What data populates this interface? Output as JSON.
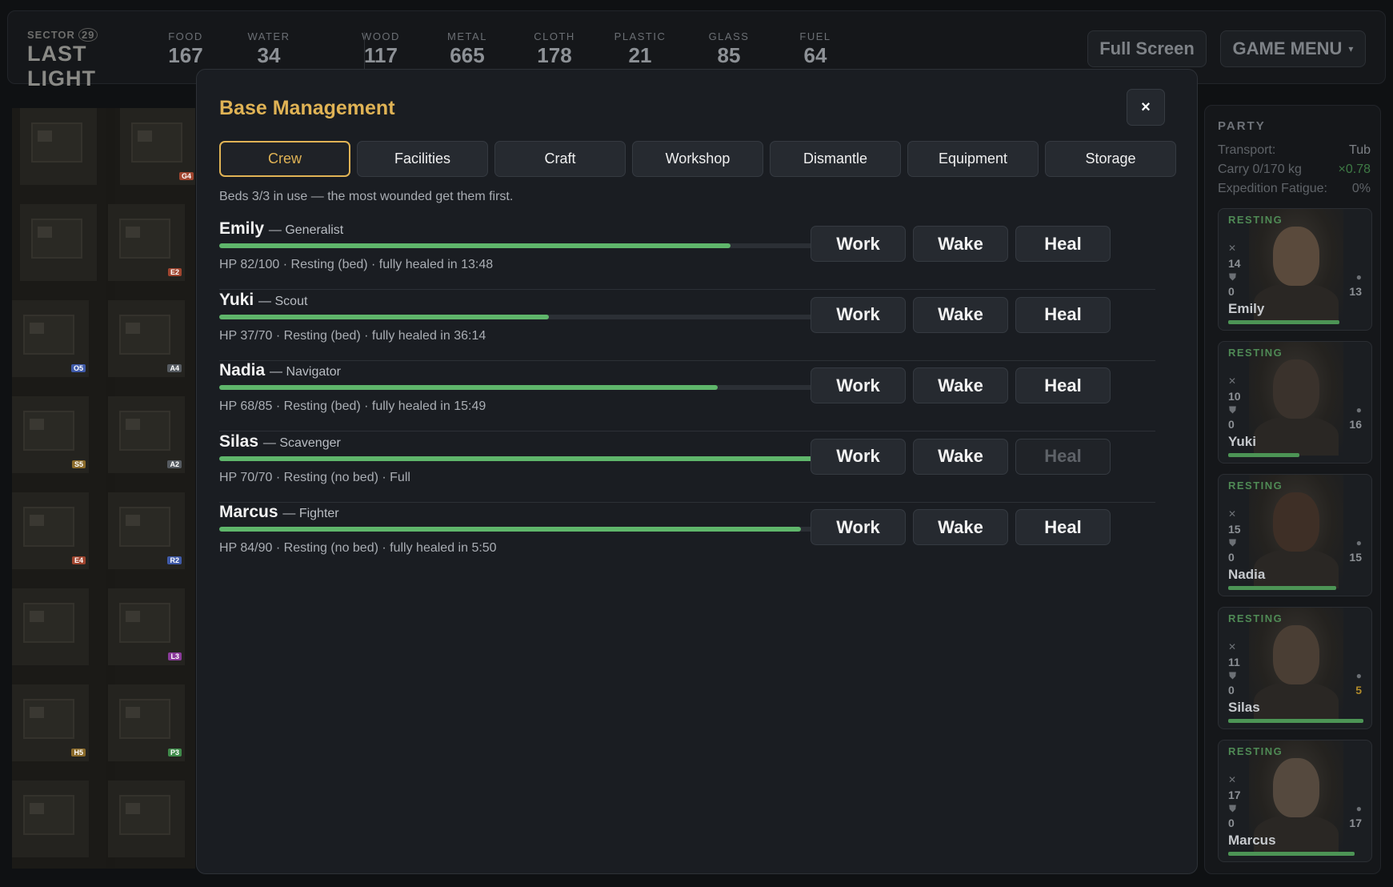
{
  "logo": {
    "line1": "SECTOR",
    "line1_num": "29",
    "line2": "LAST LIGHT"
  },
  "resources": [
    {
      "label": "FOOD",
      "value": "167"
    },
    {
      "label": "WATER",
      "value": "34"
    },
    {
      "label": "WOOD",
      "value": "117"
    },
    {
      "label": "METAL",
      "value": "665"
    },
    {
      "label": "CLOTH",
      "value": "178"
    },
    {
      "label": "PLASTIC",
      "value": "21"
    },
    {
      "label": "GLASS",
      "value": "85"
    },
    {
      "label": "FUEL",
      "value": "64"
    }
  ],
  "header": {
    "fullscreen_label": "Full Screen",
    "menu_label": "GAME MENU",
    "menu_caret": "▾"
  },
  "map": {
    "tiles": [
      {
        "tag": "G4",
        "tag_color": "#a0452f"
      },
      {
        "tag": "E2",
        "tag_color": "#a0452f"
      },
      {
        "tag": "O5",
        "tag_color": "#3f5aa8"
      },
      {
        "tag": "A4",
        "tag_color": "#555a60"
      },
      {
        "tag": "S5",
        "tag_color": "#8a6a2a"
      },
      {
        "tag": "A2",
        "tag_color": "#555a60"
      },
      {
        "tag": "E4",
        "tag_color": "#a0452f"
      },
      {
        "tag": "R2",
        "tag_color": "#3f5aa8"
      },
      {
        "tag": "L3",
        "tag_color": "#8a3a9a"
      },
      {
        "tag": "H5",
        "tag_color": "#8a6a2a"
      },
      {
        "tag": "P3",
        "tag_color": "#3f8a4a"
      }
    ]
  },
  "modal": {
    "title": "Base Management",
    "close_label": "×",
    "tabs": [
      "Crew",
      "Facilities",
      "Craft",
      "Workshop",
      "Dismantle",
      "Equipment",
      "Storage"
    ],
    "active_tab": "Crew",
    "beds_note": "Beds 3/3 in use — the most wounded get them first.",
    "crew": [
      {
        "name": "Emily",
        "role": "— Generalist",
        "hp_fraction": 0.82,
        "status": "HP 82/100 · Resting (bed) · fully healed in 13:48",
        "actions": [
          "Work",
          "Wake",
          "Heal"
        ],
        "heal_enabled": true
      },
      {
        "name": "Yuki",
        "role": "— Scout",
        "hp_fraction": 0.529,
        "status": "HP 37/70 · Resting (bed) · fully healed in 36:14",
        "actions": [
          "Work",
          "Wake",
          "Heal"
        ],
        "heal_enabled": true
      },
      {
        "name": "Nadia",
        "role": "— Navigator",
        "hp_fraction": 0.8,
        "status": "HP 68/85 · Resting (bed) · fully healed in 15:49",
        "actions": [
          "Work",
          "Wake",
          "Heal"
        ],
        "heal_enabled": true
      },
      {
        "name": "Silas",
        "role": "— Scavenger",
        "hp_fraction": 1.0,
        "status": "HP 70/70 · Resting (no bed) · Full",
        "actions": [
          "Work",
          "Wake",
          "Heal"
        ],
        "heal_enabled": false
      },
      {
        "name": "Marcus",
        "role": "— Fighter",
        "hp_fraction": 0.933,
        "status": "HP 84/90 · Resting (no bed) · fully healed in 5:50",
        "actions": [
          "Work",
          "Wake",
          "Heal"
        ],
        "heal_enabled": true
      }
    ]
  },
  "party": {
    "title": "PARTY",
    "transport_label": "Transport:",
    "transport_value": "Tub",
    "carry_label": "Carry 0/170 kg",
    "carry_value": "×0.78",
    "fatigue_label": "Expedition Fatigue:",
    "fatigue_value": "0%",
    "members": [
      {
        "status": "RESTING",
        "attack": "14",
        "defense": "0",
        "right_stat": "13",
        "right_stat_color": "#8c9095",
        "name": "Emily",
        "hp_fraction": 0.82
      },
      {
        "status": "RESTING",
        "attack": "10",
        "defense": "0",
        "right_stat": "16",
        "right_stat_color": "#8c9095",
        "name": "Yuki",
        "hp_fraction": 0.529
      },
      {
        "status": "RESTING",
        "attack": "15",
        "defense": "0",
        "right_stat": "15",
        "right_stat_color": "#8c9095",
        "name": "Nadia",
        "hp_fraction": 0.8
      },
      {
        "status": "RESTING",
        "attack": "11",
        "defense": "0",
        "right_stat": "5",
        "right_stat_color": "#b08a2a",
        "name": "Silas",
        "hp_fraction": 1.0
      },
      {
        "status": "RESTING",
        "attack": "17",
        "defense": "0",
        "right_stat": "17",
        "right_stat_color": "#8c9095",
        "name": "Marcus",
        "hp_fraction": 0.933
      }
    ]
  }
}
